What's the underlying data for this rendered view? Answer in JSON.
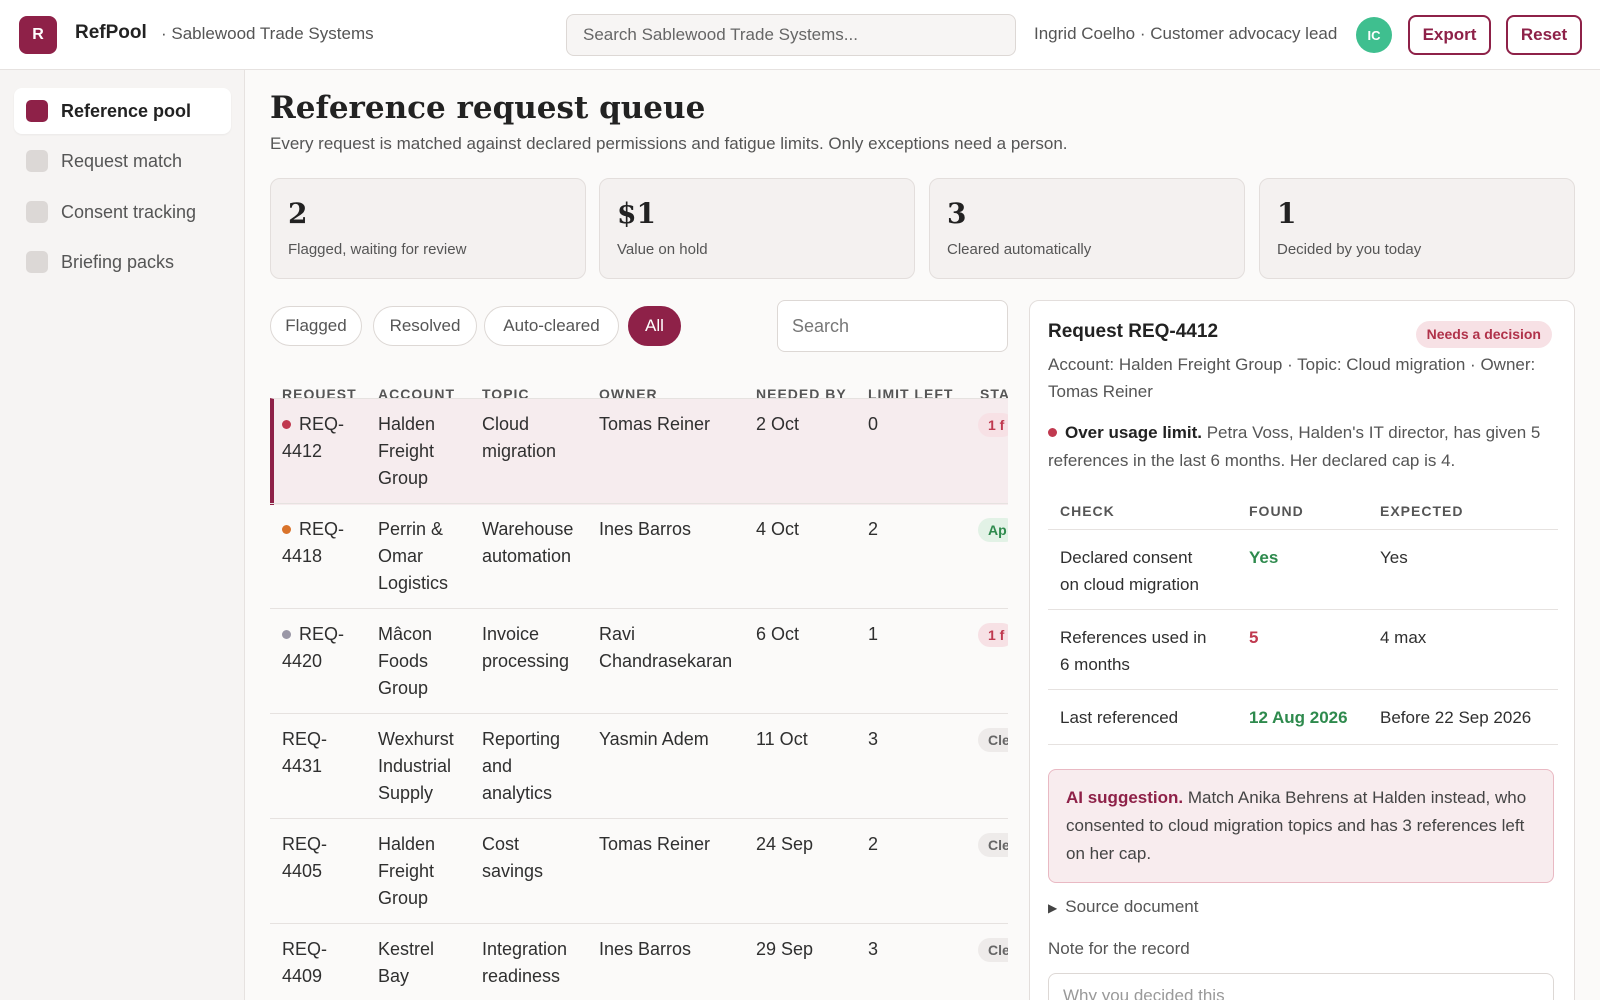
{
  "header": {
    "logo_letter": "R",
    "app_name": "RefPool",
    "org": "· Sablewood Trade Systems",
    "search_placeholder": "Search Sablewood Trade Systems...",
    "user": "Ingrid Coelho · Customer advocacy lead",
    "avatar": "IC",
    "export_label": "Export",
    "reset_label": "Reset"
  },
  "sidebar": {
    "items": [
      {
        "label": "Reference pool",
        "active": true
      },
      {
        "label": "Request match",
        "active": false
      },
      {
        "label": "Consent tracking",
        "active": false
      },
      {
        "label": "Briefing packs",
        "active": false
      }
    ]
  },
  "page": {
    "title": "Reference request queue",
    "subtitle": "Every request is matched against declared permissions and fatigue limits. Only exceptions need a person."
  },
  "stats": [
    {
      "value": "2",
      "label": "Flagged, waiting for review"
    },
    {
      "value": "$1",
      "label": "Value on hold"
    },
    {
      "value": "3",
      "label": "Cleared automatically"
    },
    {
      "value": "1",
      "label": "Decided by you today"
    }
  ],
  "filters": {
    "pills": [
      "Flagged",
      "Resolved",
      "Auto-cleared",
      "All"
    ],
    "active": "All",
    "search_placeholder": "Search"
  },
  "table": {
    "columns": [
      "REQUEST",
      "ACCOUNT",
      "TOPIC",
      "OWNER",
      "NEEDED BY",
      "LIMIT LEFT",
      "STA"
    ],
    "rows": [
      {
        "id": "REQ-\n4412",
        "account": "Halden\nFreight\nGroup",
        "topic": "Cloud\nmigration",
        "owner": "Tomas Reiner",
        "needed": "2 Oct",
        "limit": "0",
        "status": "1 f",
        "status_kind": "red",
        "dot": "#c0394f",
        "selected": true
      },
      {
        "id": "REQ-\n4418",
        "account": "Perrin &\nOmar\nLogistics",
        "topic": "Warehouse\nautomation",
        "owner": "Ines Barros",
        "needed": "4 Oct",
        "limit": "2",
        "status": "Ap",
        "status_kind": "green",
        "dot": "#d9732b",
        "selected": false
      },
      {
        "id": "REQ-\n4420",
        "account": "Mâcon\nFoods\nGroup",
        "topic": "Invoice\nprocessing",
        "owner": "Ravi\nChandrasekaran",
        "needed": "6 Oct",
        "limit": "1",
        "status": "1 f",
        "status_kind": "red",
        "dot": "#9a97a6",
        "selected": false
      },
      {
        "id": "REQ-\n4431",
        "account": "Wexhurst\nIndustrial\nSupply",
        "topic": "Reporting\nand\nanalytics",
        "owner": "Yasmin Adem",
        "needed": "11 Oct",
        "limit": "3",
        "status": "Cle",
        "status_kind": "grey",
        "dot": "",
        "selected": false
      },
      {
        "id": "REQ-\n4405",
        "account": "Halden\nFreight\nGroup",
        "topic": "Cost\nsavings",
        "owner": "Tomas Reiner",
        "needed": "24 Sep",
        "limit": "2",
        "status": "Cle",
        "status_kind": "grey",
        "dot": "",
        "selected": false
      },
      {
        "id": "REQ-\n4409",
        "account": "Kestrel\nBay",
        "topic": "Integration\nreadiness",
        "owner": "Ines Barros",
        "needed": "29 Sep",
        "limit": "3",
        "status": "Cle",
        "status_kind": "grey",
        "dot": "",
        "selected": false
      }
    ]
  },
  "detail": {
    "title": "Request REQ-4412",
    "badge": "Needs a decision",
    "meta": "Account: Halden Freight Group · Topic: Cloud migration · Owner: Tomas Reiner",
    "alert_title": "Over usage limit.",
    "alert_text": " Petra Voss, Halden's IT director, has given 5 references in the last 6 months. Her declared cap is 4.",
    "check_columns": [
      "CHECK",
      "FOUND",
      "EXPECTED"
    ],
    "checks": [
      {
        "check": "Declared consent\non cloud migration",
        "found": "Yes",
        "found_kind": "green",
        "expected": "Yes"
      },
      {
        "check": "References used in\n6 months",
        "found": "5",
        "found_kind": "red",
        "expected": "4 max"
      },
      {
        "check": "Last referenced",
        "found": "12 Aug 2026",
        "found_kind": "green",
        "expected": "Before 22 Sep 2026"
      }
    ],
    "ai_title": "AI suggestion.",
    "ai_text": " Match Anika Behrens at Halden instead, who consented to cloud migration topics and has 3 references left on her cap.",
    "source_doc": "Source document",
    "note_label": "Note for the record",
    "note_placeholder": "Why you decided this"
  }
}
